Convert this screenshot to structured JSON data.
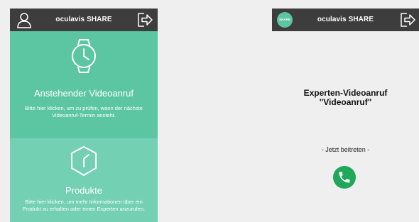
{
  "left_screen": {
    "header": {
      "title": "oculavis SHARE",
      "profile_icon": "user-icon",
      "logout_icon": "logout-icon"
    },
    "tiles": [
      {
        "icon": "watch-icon",
        "heading": "Anstehender Videoanruf",
        "description": "Bitte hier klicken, um zu prüfen, wann der nächste Videoanruf-Termin ansteht."
      },
      {
        "icon": "box-icon",
        "heading": "Produkte",
        "description": "Bitte hier klicken, um mehr Informationen über ein Produkt zu erhalten oder einen Experten anzurufen."
      }
    ],
    "colors": {
      "header": "#3d3d3d",
      "tile_top": "#5cc6a3",
      "tile_bottom": "#74d0b2"
    }
  },
  "right_screen": {
    "header": {
      "logo_text": "SHARE",
      "title": "oculavis SHARE",
      "logout_icon": "logout-icon"
    },
    "call": {
      "title_line1": "Experten-Videoanruf",
      "title_line2": "\"Videoanruf\"",
      "join_text": "- Jetzt beitreten -",
      "call_icon": "phone-icon"
    },
    "colors": {
      "header": "#3d3d3d",
      "call_button": "#1ea85a",
      "background": "#efefef"
    }
  }
}
